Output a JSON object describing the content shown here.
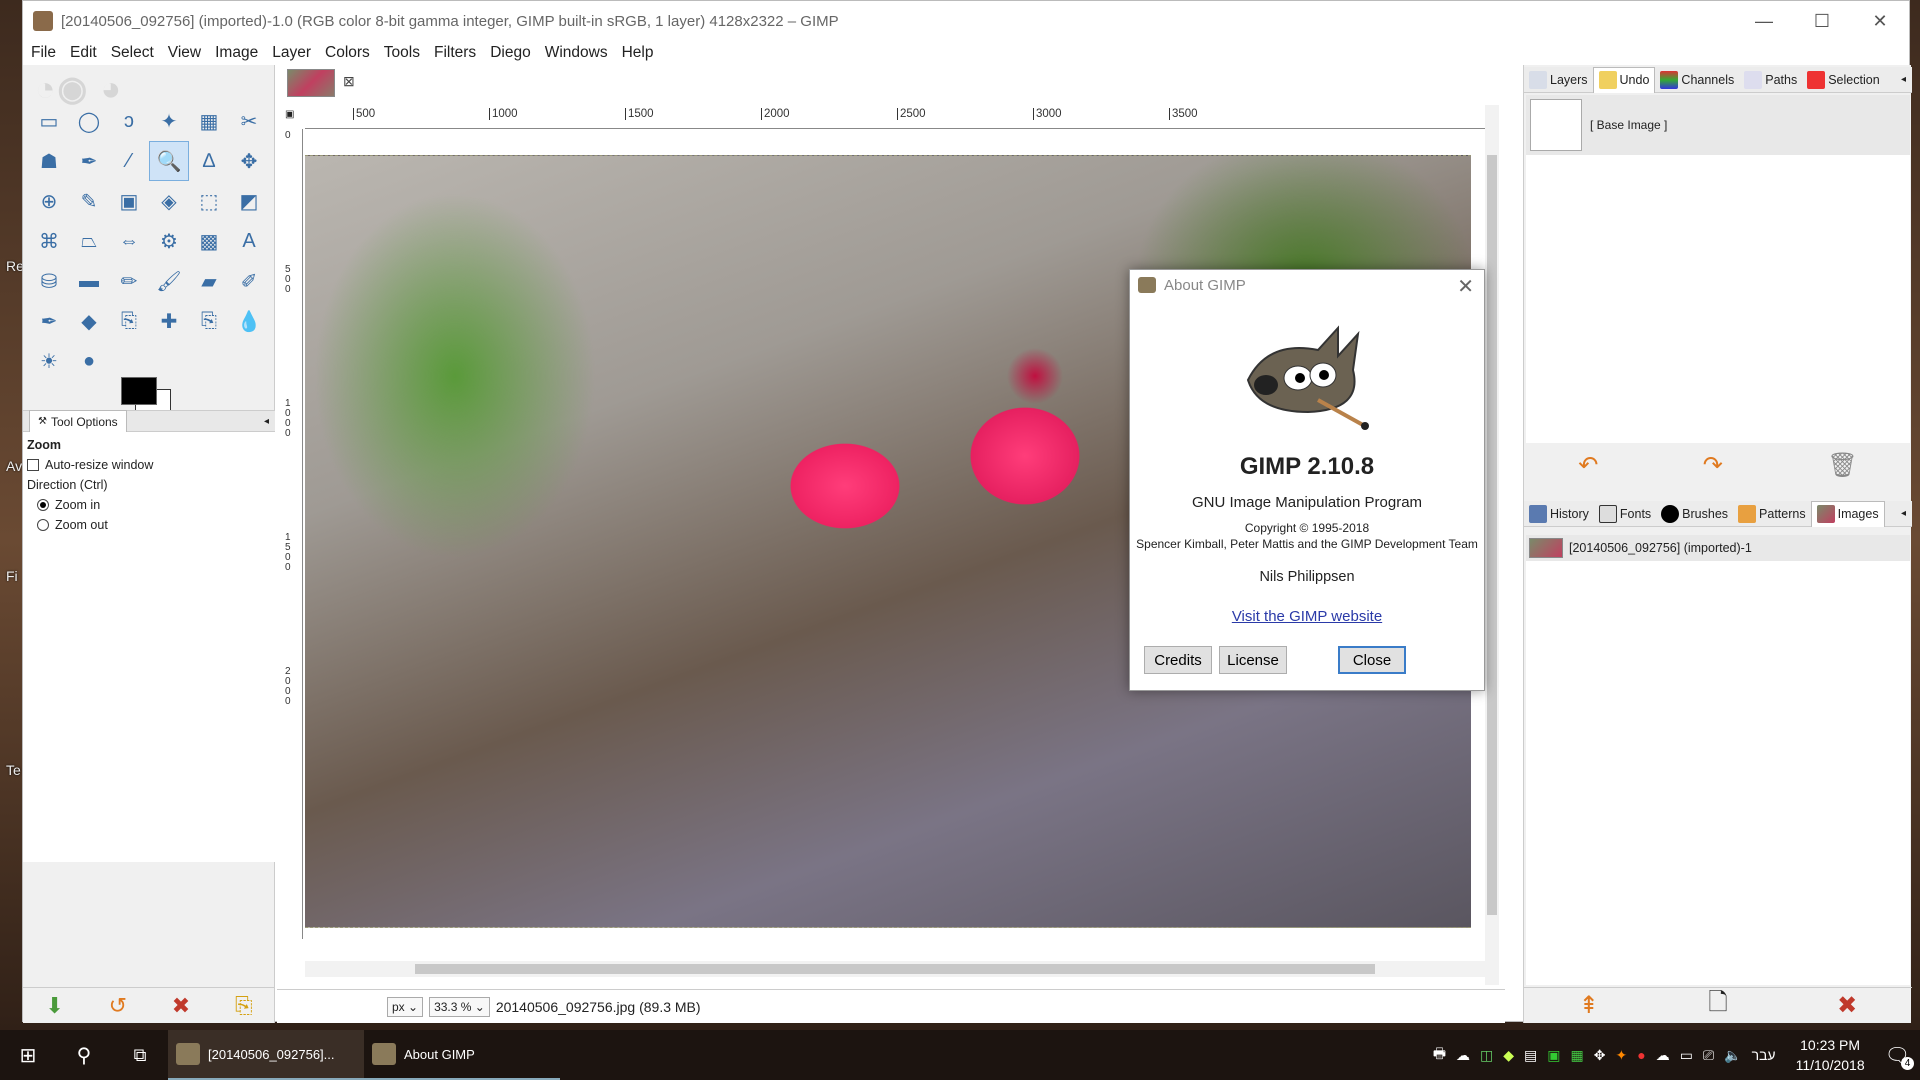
{
  "window": {
    "title": "[20140506_092756] (imported)-1.0 (RGB color 8-bit gamma integer, GIMP built-in sRGB, 1 layer) 4128x2322 – GIMP"
  },
  "desktop_labels": [
    "Re",
    "Av",
    "Fi",
    "Te"
  ],
  "menu": [
    "File",
    "Edit",
    "Select",
    "View",
    "Image",
    "Layer",
    "Colors",
    "Tools",
    "Filters",
    "Diego",
    "Windows",
    "Help"
  ],
  "toolbox": {
    "tools": [
      "rect-select",
      "ellipse-select",
      "free-select",
      "fuzzy-select",
      "color-select",
      "scissors",
      "foreground-select",
      "paths",
      "color-picker",
      "zoom",
      "measure",
      "move",
      "align",
      "crop",
      "unified-transform",
      "rotate",
      "scale",
      "shear",
      "cage-transform",
      "perspective",
      "flip",
      "handle-transform",
      "warp",
      "text",
      "bucket-fill",
      "blend",
      "pencil",
      "paintbrush",
      "eraser",
      "airbrush",
      "ink",
      "mypaint-brush",
      "clone",
      "heal",
      "perspective-clone",
      "smudge",
      "blur",
      "dodge-burn"
    ],
    "tool_icons": [
      "▭",
      "◯",
      "ↄ",
      "✦",
      "▦",
      "✂",
      "☗",
      "✒",
      "⁄",
      "🔍",
      "∆",
      "✥",
      "⊕",
      "✎",
      "▣",
      "◈",
      "⬚",
      "◩",
      "⌘",
      "⏢",
      "⇔",
      "⚙",
      "▩",
      "A",
      "⛁",
      "▬",
      "✏",
      "🖌",
      "▰",
      "✐",
      "✒",
      "◆",
      "⎘",
      "✚",
      "⎘",
      "💧",
      "☀",
      "●"
    ],
    "tool_options_tab": "Tool Options",
    "options": {
      "title": "Zoom",
      "auto_resize": "Auto-resize window",
      "direction_label": "Direction  (Ctrl)",
      "zoom_in": "Zoom in",
      "zoom_out": "Zoom out"
    },
    "bottom_icons": [
      "⬇",
      "↺",
      "✖",
      "⎘"
    ]
  },
  "ruler": {
    "h_ticks": [
      "500",
      "1000",
      "1500",
      "2000",
      "2500",
      "3000",
      "3500"
    ],
    "v_ticks": [
      "0",
      "500",
      "1000",
      "1500",
      "2000"
    ]
  },
  "status": {
    "unit": "px",
    "zoom": "33.3 %",
    "file_info": "20140506_092756.jpg (89.3 MB)"
  },
  "dock": {
    "top_tabs": [
      "Layers",
      "Undo",
      "Channels",
      "Paths",
      "Selection"
    ],
    "undo_item": "[ Base Image ]",
    "undo_icons": [
      "↶",
      "↷",
      "🗑"
    ],
    "mid_tabs": [
      "History",
      "Fonts",
      "Brushes",
      "Patterns",
      "Images"
    ],
    "images_item": "[20140506_092756] (imported)-1",
    "bottom_icons": [
      "⇞",
      "🗋",
      "✖"
    ]
  },
  "about": {
    "title": "About GIMP",
    "name": "GIMP 2.10.8",
    "subtitle": "GNU Image Manipulation Program",
    "copyright": "Copyright © 1995-2018",
    "team": "Spencer Kimball, Peter Mattis and the GIMP Development Team",
    "author": "Nils Philippsen",
    "link": "Visit the GIMP website",
    "credits": "Credits",
    "license": "License",
    "close": "Close"
  },
  "taskbar": {
    "items": [
      "[20140506_092756]...",
      "About GIMP"
    ],
    "lang": "עבר",
    "time": "10:23 PM",
    "date": "11/10/2018",
    "notifications": "4"
  },
  "colors": {
    "accent": "#3a7cc8",
    "fg": "#000000",
    "bg": "#ffffff",
    "link": "#2a3aa8"
  }
}
